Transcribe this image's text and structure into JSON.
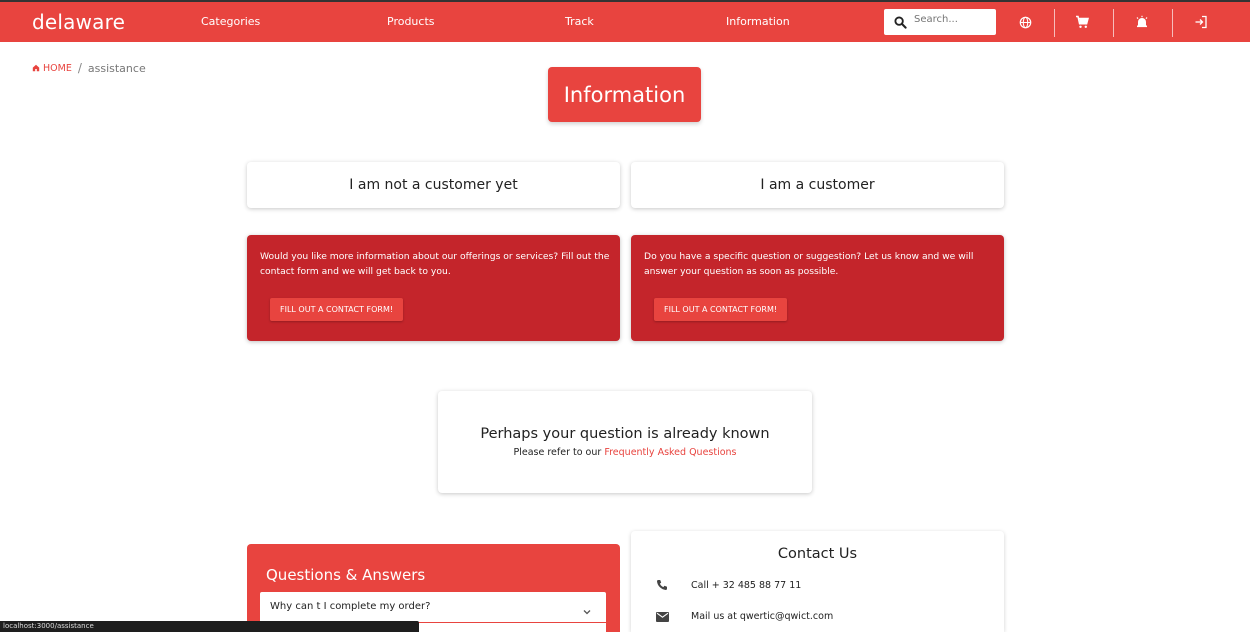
{
  "header": {
    "logo": "delaware",
    "nav": [
      "Categories",
      "Products",
      "Track",
      "Information"
    ],
    "search_placeholder": "Search...",
    "icons": [
      "globe-icon",
      "cart-icon",
      "notification-icon",
      "login-icon"
    ],
    "brand_color": "#e8443f"
  },
  "breadcrumb": {
    "home": "HOME",
    "separator": "/",
    "current": "assistance"
  },
  "page_title": "Information",
  "tabs": [
    "I am not a customer yet",
    "I am a customer"
  ],
  "cards": [
    {
      "text": "Would you like more information about our offerings or services? Fill out the contact form and we will get back to you.",
      "button": "FILL OUT A CONTACT FORM!"
    },
    {
      "text": "Do you have a specific question or suggestion? Let us know and we will answer your question as soon as possible.",
      "button": "FILL OUT A CONTACT FORM!"
    }
  ],
  "faq": {
    "title": "Perhaps your question is already known",
    "prefix": "Please refer to our",
    "link": "Frequently Asked Questions"
  },
  "qa": {
    "title": "Questions & Answers",
    "items": [
      "Why can t I complete my order?"
    ]
  },
  "contact": {
    "title": "Contact Us",
    "phone": "Call + 32 485 88 77 11",
    "mail": "Mail us at qwertic@qwict.com"
  },
  "status_bar": "localhost:3000/assistance"
}
